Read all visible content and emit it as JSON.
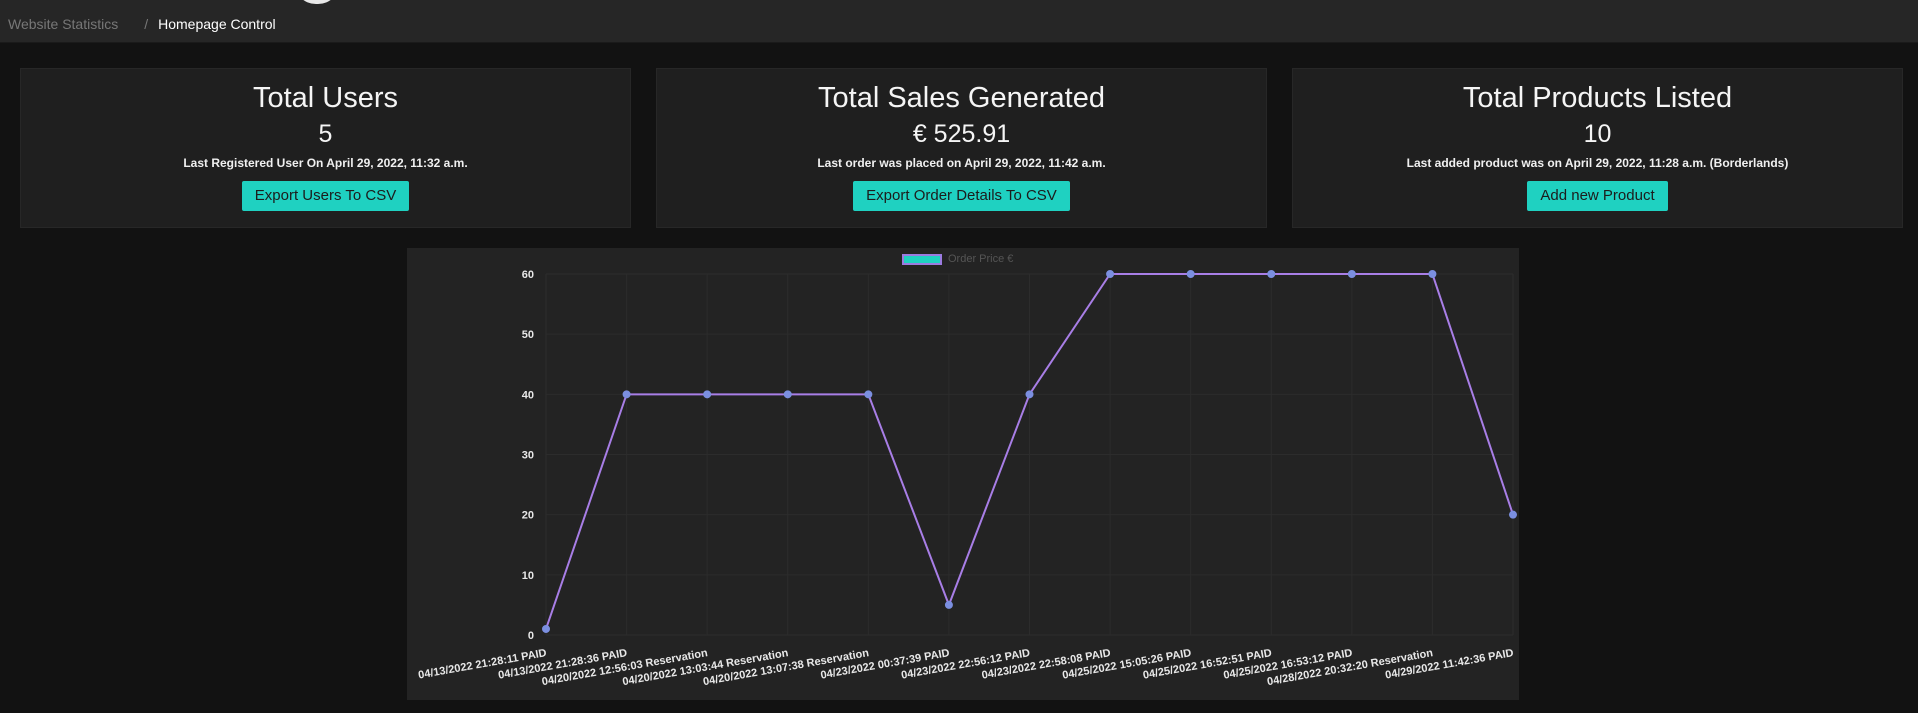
{
  "breadcrumb": {
    "item1": "Website Statistics",
    "separator": "/",
    "current": "Homepage Control"
  },
  "cards": [
    {
      "title": "Total Users",
      "value": "5",
      "note": "Last Registered User On April 29, 2022, 11:32 a.m.",
      "button": "Export Users To CSV"
    },
    {
      "title": "Total Sales Generated",
      "value": "€ 525.91",
      "note": "Last order was placed on April 29, 2022, 11:42 a.m.",
      "button": "Export Order Details To CSV"
    },
    {
      "title": "Total Products Listed",
      "value": "10",
      "note": "Last added product was on April 29, 2022, 11:28 a.m. (Borderlands)",
      "button": "Add new Product"
    }
  ],
  "colors": {
    "accent": "#1fd1c1",
    "line": "#a87ee6",
    "point": "#7b8fe0"
  },
  "chart_data": {
    "type": "line",
    "legend": "Order Price €",
    "legend_position": "top-center",
    "categories": [
      "04/13/2022 21:28:11 PAID",
      "04/13/2022 21:28:36 PAID",
      "04/20/2022 12:56:03 Reservation",
      "04/20/2022 13:03:44 Reservation",
      "04/20/2022 13:07:38 Reservation",
      "04/23/2022 00:37:39 PAID",
      "04/23/2022 22:56:12 PAID",
      "04/23/2022 22:58:08 PAID",
      "04/25/2022 15:05:26 PAID",
      "04/25/2022 16:52:51 PAID",
      "04/25/2022 16:53:12 PAID",
      "04/28/2022 20:32:20 Reservation",
      "04/29/2022 11:42:36 PAID"
    ],
    "series": [
      {
        "name": "Order Price €",
        "values": [
          1,
          40,
          40,
          40,
          40,
          5,
          40,
          60,
          60,
          60,
          60,
          60,
          20
        ]
      }
    ],
    "yticks": [
      "0",
      "10",
      "20",
      "30",
      "40",
      "50",
      "60"
    ],
    "ylim": [
      0,
      60
    ],
    "grid": true
  }
}
